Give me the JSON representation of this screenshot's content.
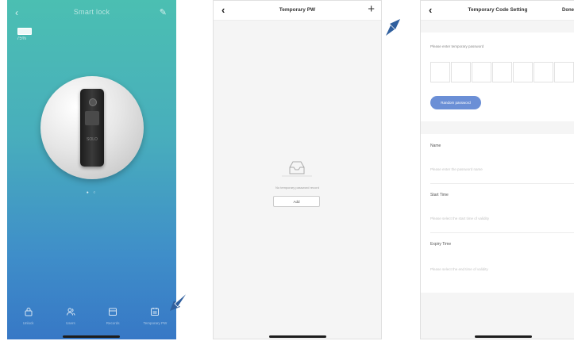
{
  "screen1": {
    "title": "Smart lock",
    "battery_label": "75%",
    "device_brand": "SOLO",
    "page_dots": "● ○",
    "nav": [
      {
        "label": "Unlock",
        "icon": "lock-icon"
      },
      {
        "label": "Users",
        "icon": "users-icon"
      },
      {
        "label": "Records",
        "icon": "records-icon"
      },
      {
        "label": "Temporary PW",
        "icon": "calendar-icon"
      }
    ]
  },
  "screen2": {
    "title": "Temporary PW",
    "back_glyph": "‹",
    "add_glyph": "+",
    "empty_text": "No temporary password record",
    "add_button_label": "Add"
  },
  "screen3": {
    "title": "Temporary Code Setting",
    "back_glyph": "‹",
    "done_label": "Done",
    "prompt": "Please enter temporary password",
    "code_box_count": 7,
    "generate_label": "Random password",
    "fields": [
      {
        "label": "Name",
        "placeholder": "Please enter the password name"
      },
      {
        "label": "Start Time",
        "placeholder": "Please select the start time of validity"
      },
      {
        "label": "Expiry Time",
        "placeholder": "Please select the end time of validity"
      }
    ]
  },
  "colors": {
    "gradient_top": "#4bbfb2",
    "gradient_bottom": "#3778c6",
    "accent_button": "#6b8fd6",
    "arrow": "#2f5f9e"
  }
}
